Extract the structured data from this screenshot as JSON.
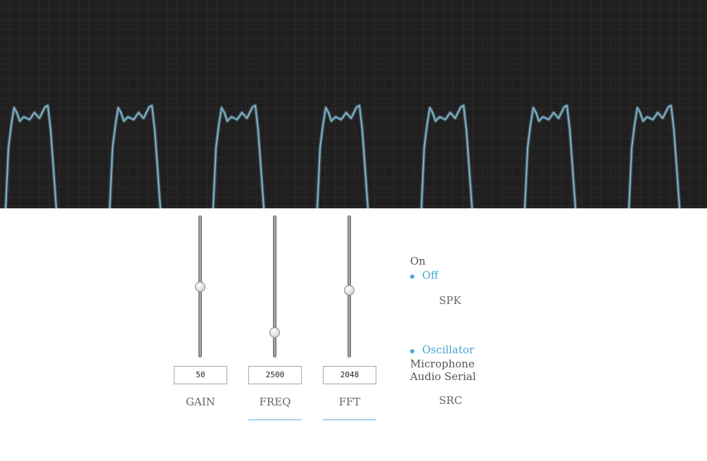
{
  "scope": {
    "background": "#1f1f1f",
    "grid_color": "#2b2b2b",
    "trace_color": "#7fb3c8"
  },
  "sliders": [
    {
      "id": "gain",
      "label": "GAIN",
      "value": "50",
      "level": 0.5,
      "underline": false
    },
    {
      "id": "freq",
      "label": "FREQ",
      "value": "2500",
      "level": 0.15,
      "underline": true
    },
    {
      "id": "fft",
      "label": "FFT",
      "value": "2048",
      "level": 0.47,
      "underline": true
    }
  ],
  "speaker": {
    "label": "SPK",
    "options": [
      {
        "label": "On",
        "selected": false
      },
      {
        "label": "Off",
        "selected": true
      }
    ]
  },
  "source": {
    "label": "SRC",
    "options": [
      {
        "label": "Oscillator",
        "selected": true
      },
      {
        "label": "Microphone",
        "selected": false
      },
      {
        "label": "Audio Serial",
        "selected": false
      }
    ]
  },
  "accent_color": "#4aa4d8"
}
